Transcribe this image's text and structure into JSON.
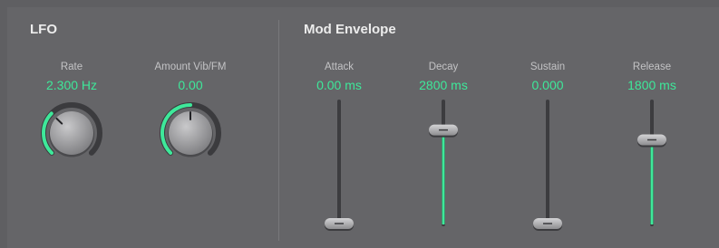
{
  "colors": {
    "accent": "#3ee89a",
    "background": "#656568",
    "label": "#c3c3c5",
    "title": "#ececec"
  },
  "lfo": {
    "title": "LFO",
    "rate": {
      "label": "Rate",
      "value": "2.300 Hz",
      "level": 0.33
    },
    "amount": {
      "label": "Amount Vib/FM",
      "value": "0.00",
      "level": 0.5
    }
  },
  "mod_envelope": {
    "title": "Mod Envelope",
    "sliders": [
      {
        "label": "Attack",
        "value": "0.00 ms",
        "level": 0.0
      },
      {
        "label": "Decay",
        "value": "2800 ms",
        "level": 0.76
      },
      {
        "label": "Sustain",
        "value": "0.000",
        "level": 0.0
      },
      {
        "label": "Release",
        "value": "1800 ms",
        "level": 0.68
      }
    ]
  }
}
